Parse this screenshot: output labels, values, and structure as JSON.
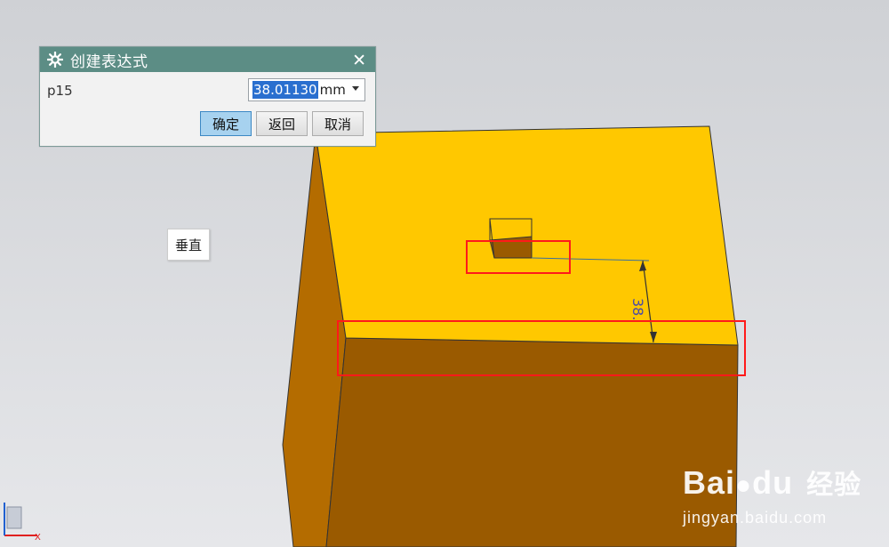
{
  "dialog": {
    "title": "创建表达式",
    "param_label": "p15",
    "value": "38.01130",
    "unit": "mm",
    "buttons": {
      "ok": "确定",
      "back": "返回",
      "cancel": "取消"
    }
  },
  "view_label": "垂直",
  "dimension_text": "38.",
  "axis": {
    "x": "X"
  },
  "watermark": {
    "logo": "Bai",
    "logo_rest": "du",
    "logo_cn": "经验",
    "site": "jingyan.baidu.com"
  },
  "colors": {
    "top_face": "#ffc800",
    "side_face": "#9e5c00",
    "left_face": "#b26a00",
    "highlight": "#ff1a1a",
    "dialog_title": "#5c8d85",
    "ok_button": "#a7d2ef"
  }
}
